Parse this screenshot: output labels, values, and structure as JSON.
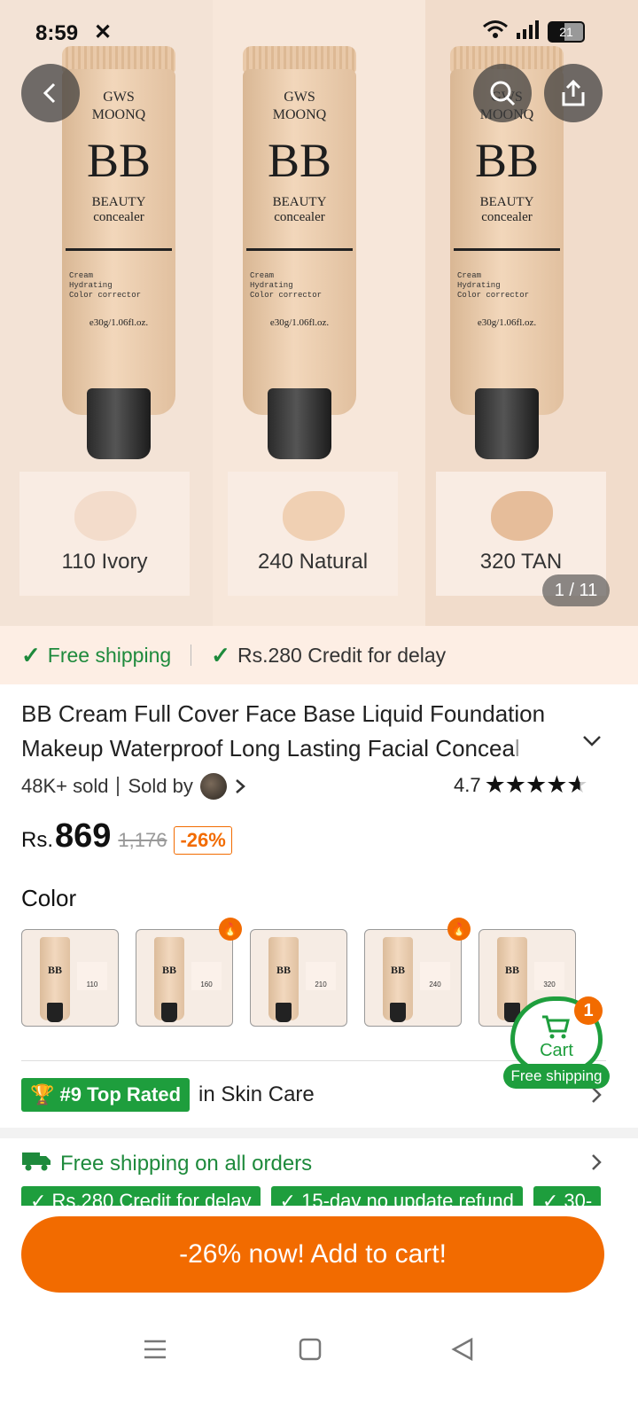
{
  "status_bar": {
    "time": "8:59",
    "battery": "21"
  },
  "gallery": {
    "products": [
      {
        "brand_line1": "GWS",
        "brand_line2": "MOONQ",
        "bb": "BB",
        "beauty": "BEAUTY",
        "concealer": "concealer",
        "desc": "Cream\nHydrating\nColor corrector",
        "volume": "e30g/1.06fl.oz.",
        "shade": "110 Ivory",
        "swatch_color": "#f3dccb"
      },
      {
        "brand_line1": "GWS",
        "brand_line2": "MOONQ",
        "bb": "BB",
        "beauty": "BEAUTY",
        "concealer": "concealer",
        "desc": "Cream\nHydrating\nColor corrector",
        "volume": "e30g/1.06fl.oz.",
        "shade": "240 Natural",
        "swatch_color": "#f0d0b3"
      },
      {
        "brand_line1": "GWS",
        "brand_line2": "MOONQ",
        "bb": "BB",
        "beauty": "BEAUTY",
        "concealer": "concealer",
        "desc": "Cream\nHydrating\nColor corrector",
        "volume": "e30g/1.06fl.oz.",
        "shade": "320 TAN",
        "swatch_color": "#e6bd9a"
      }
    ],
    "pager": "1 / 11"
  },
  "shipping_strip": {
    "free": "Free shipping",
    "credit": "Rs.280 Credit for delay"
  },
  "product": {
    "title_main": "BB Cream Full Cover Face Base Liquid Foundation Makeup Waterproof Long Lasting Facial Concea",
    "title_fade": "l",
    "sold": "48K+ sold",
    "sold_by": "Sold by",
    "rating": "4.7",
    "currency": "Rs.",
    "price": "869",
    "old_price": "1,176",
    "discount": "-26%"
  },
  "color": {
    "label": "Color",
    "options": [
      {
        "code": "110"
      },
      {
        "code": "160"
      },
      {
        "code": "210"
      },
      {
        "code": "240"
      },
      {
        "code": "320"
      }
    ]
  },
  "cart_float": {
    "count": "1",
    "label": "Cart",
    "ship": "Free shipping"
  },
  "top_rated": {
    "badge": "#9 Top Rated",
    "category": "in Skin Care"
  },
  "free_all": "Free shipping on all orders",
  "chips": [
    "✓ Rs.280 Credit for delay",
    "✓ 15-day no update refund",
    "✓ 30-"
  ],
  "add_to_cart": "-26% now! Add to cart!",
  "colors": {
    "accent": "#f26b00",
    "green": "#1e9e3d"
  }
}
